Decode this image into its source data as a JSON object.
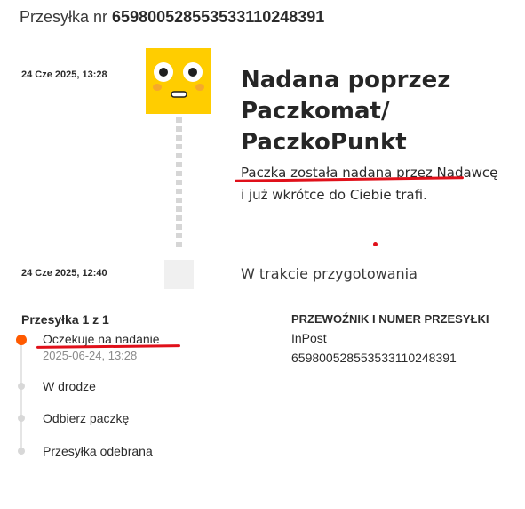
{
  "header": {
    "prefix": "Przesyłka nr",
    "tracking_number": "659800528553533110248391"
  },
  "timeline": [
    {
      "timestamp": "24 Cze 2025, 13:28",
      "title": "Nadana poprzez Paczkomat/ PaczkoPunkt",
      "description": "Paczka została nadana przez Nadawcę i już wkrótce do Ciebie trafi.",
      "icon": "inpost-mascot-icon"
    },
    {
      "timestamp": "24 Cze 2025, 12:40",
      "title": "W trakcie przygotowania",
      "icon": "status-placeholder-icon"
    }
  ],
  "shipment": {
    "count_label": "Przesyłka 1 z 1",
    "steps": [
      {
        "label": "Oczekuje na nadanie",
        "date": "2025-06-24, 13:28",
        "active": true
      },
      {
        "label": "W drodze",
        "active": false
      },
      {
        "label": "Odbierz paczkę",
        "active": false
      },
      {
        "label": "Przesyłka odebrana",
        "active": false
      }
    ]
  },
  "carrier": {
    "heading": "PRZEWOŹNIK I NUMER PRZESYŁKI",
    "name": "InPost",
    "number": "659800528553533110248391"
  },
  "colors": {
    "brand_yellow": "#ffcd00",
    "active_step": "#ff5a00",
    "annotation_red": "#e0101a"
  }
}
